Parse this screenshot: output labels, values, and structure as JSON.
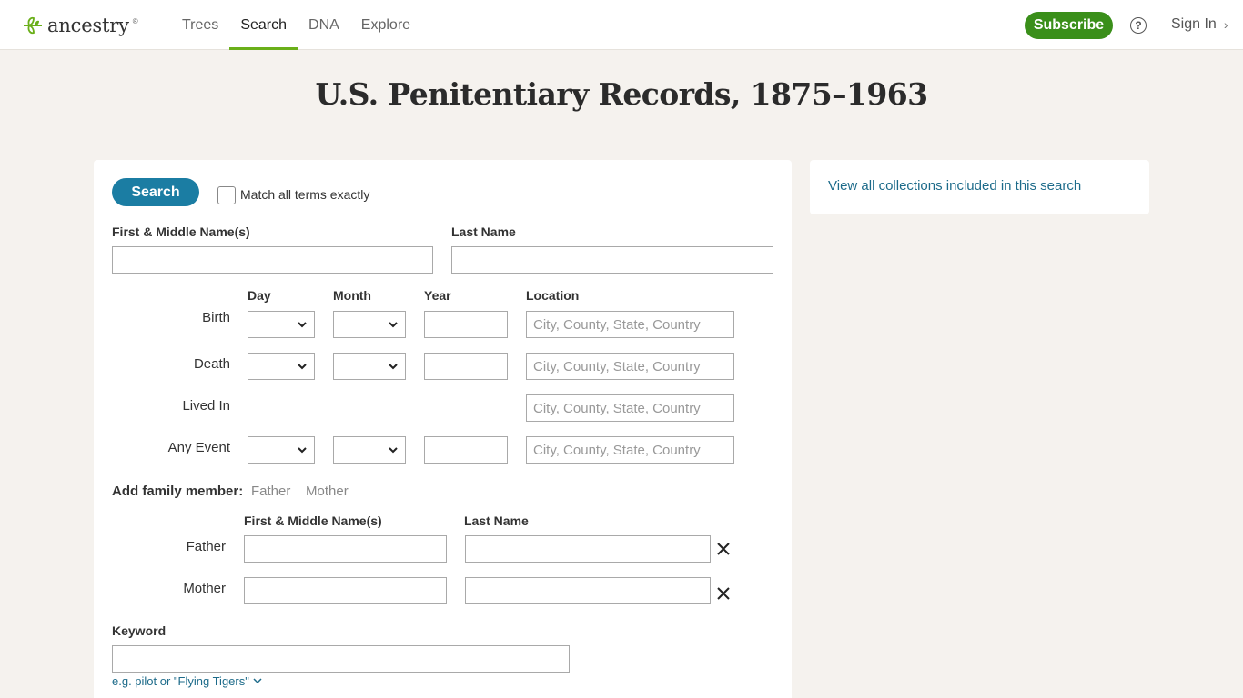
{
  "header": {
    "logo_text": "ancestry",
    "logo_tm": "®",
    "nav": [
      "Trees",
      "Search",
      "DNA",
      "Explore"
    ],
    "subscribe_label": "Subscribe",
    "help_label": "?",
    "signin_label": "Sign In",
    "accent": "#6aaf19"
  },
  "page": {
    "title": "U.S. Penitentiary Records, 1875–1963"
  },
  "form": {
    "search_label": "Search",
    "exact_label": "Match all terms exactly",
    "first_name_label": "First & Middle Name(s)",
    "last_name_label": "Last Name",
    "col_day": "Day",
    "col_month": "Month",
    "col_year": "Year",
    "col_location": "Location",
    "row_birth": "Birth",
    "row_death": "Death",
    "row_lived": "Lived In",
    "row_any": "Any Event",
    "location_placeholder": "City, County, State, Country",
    "dash": "—",
    "add_family_label": "Add family member:",
    "father_link": "Father",
    "mother_link": "Mother",
    "fam_first_label": "First & Middle Name(s)",
    "fam_last_label": "Last Name",
    "father_row": "Father",
    "mother_row": "Mother",
    "keyword_label": "Keyword",
    "keyword_hint": "e.g. pilot or \"Flying Tigers\""
  },
  "sidebar": {
    "link": "View all collections included in this search"
  },
  "colors": {
    "search_button": "#1b7da3",
    "subscribe": "#3a8f1a",
    "link": "#1d6b8a"
  }
}
